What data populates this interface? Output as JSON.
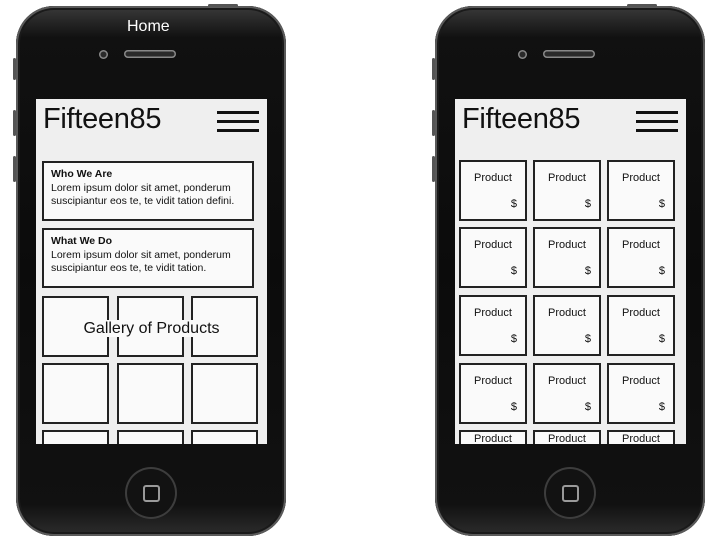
{
  "left_phone": {
    "caption": "Home",
    "brand": "Fifteen85",
    "sections": [
      {
        "title": "Who We Are",
        "text": "Lorem ipsum dolor sit amet, ponderum suscipiantur eos te, te vidit tation defini."
      },
      {
        "title": "What We Do",
        "text": "Lorem ipsum dolor sit amet, ponderum suscipiantur eos te, te vidit tation."
      }
    ],
    "gallery_label": "Gallery of Products"
  },
  "right_phone": {
    "brand": "Fifteen85",
    "product_label": "Product",
    "price_label": "$"
  }
}
